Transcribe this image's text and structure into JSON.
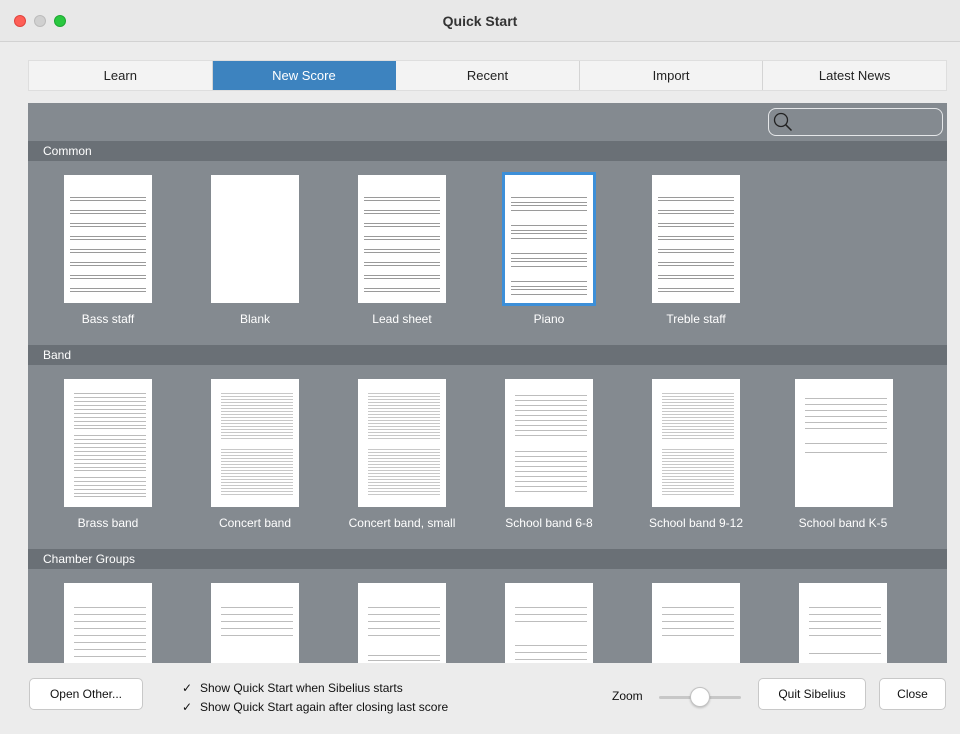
{
  "window": {
    "title": "Quick Start"
  },
  "tabs": [
    {
      "label": "Learn",
      "active": false
    },
    {
      "label": "New Score",
      "active": true
    },
    {
      "label": "Recent",
      "active": false
    },
    {
      "label": "Import",
      "active": false
    },
    {
      "label": "Latest News",
      "active": false
    }
  ],
  "search": {
    "placeholder": "",
    "icon": "search-icon"
  },
  "sections": {
    "common": {
      "title": "Common",
      "items": [
        "Bass staff",
        "Blank",
        "Lead sheet",
        "Piano",
        "Treble staff"
      ],
      "selected": "Piano"
    },
    "band": {
      "title": "Band",
      "items": [
        "Brass band",
        "Concert band",
        "Concert band, small",
        "School band 6-8",
        "School band 9-12",
        "School band K-5"
      ]
    },
    "chamber": {
      "title": "Chamber Groups"
    }
  },
  "footer": {
    "open_other": "Open Other...",
    "check_show_on_start": "Show Quick Start when Sibelius starts",
    "check_show_after_close": "Show Quick Start again after closing last score",
    "check_show_on_start_checked": true,
    "check_show_after_close_checked": true,
    "checkmark": "✓",
    "zoom_label": "Zoom",
    "zoom_level": 0.45,
    "quit": "Quit Sibelius",
    "close": "Close"
  },
  "colors": {
    "accent": "#3d83bf",
    "panel": "#848a90",
    "section_header": "#6a7076",
    "selection": "#3d8fd8"
  }
}
